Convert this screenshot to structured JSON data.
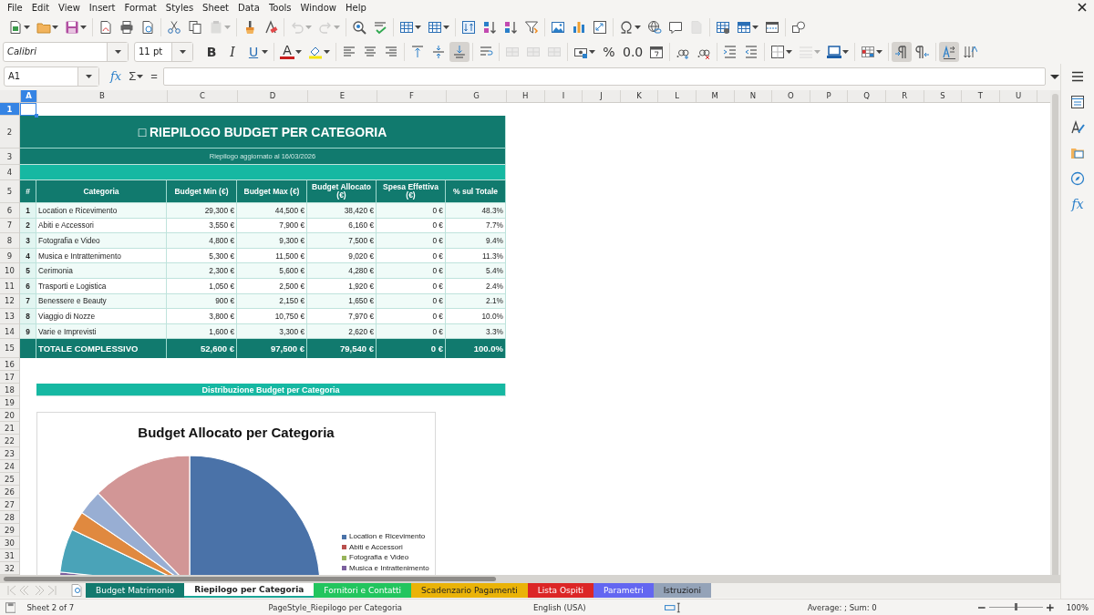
{
  "menu": [
    "File",
    "Edit",
    "View",
    "Insert",
    "Format",
    "Styles",
    "Sheet",
    "Data",
    "Tools",
    "Window",
    "Help"
  ],
  "toolbar_1": [
    [
      {
        "kind": "document",
        "on": false,
        "disabled": false
      },
      {
        "kind": "folder",
        "on": false,
        "disabled": false
      },
      {
        "kind": "floppy-disk",
        "on": false,
        "disabled": false
      }
    ],
    [
      {
        "kind": "pdf-document",
        "on": false,
        "disabled": false
      },
      {
        "kind": "printer",
        "on": false,
        "disabled": false
      },
      {
        "kind": "print-preview",
        "on": false,
        "disabled": false
      }
    ],
    [
      {
        "kind": "scissors",
        "on": false,
        "disabled": false
      },
      {
        "kind": "copy",
        "on": false,
        "disabled": false
      },
      {
        "kind": "clipboard",
        "on": false,
        "disabled": true
      }
    ],
    [
      {
        "kind": "paintbrush",
        "on": false,
        "disabled": false
      },
      {
        "kind": "clear-format",
        "on": false,
        "disabled": false
      }
    ],
    [
      {
        "kind": "undo",
        "on": false,
        "disabled": true
      },
      {
        "kind": "redo",
        "on": false,
        "disabled": true
      }
    ],
    [
      {
        "kind": "find-replace",
        "on": false,
        "disabled": false
      },
      {
        "kind": "spellcheck",
        "on": false,
        "disabled": false
      }
    ],
    [
      {
        "kind": "row-table",
        "on": false,
        "disabled": false
      },
      {
        "kind": "column-table",
        "on": false,
        "disabled": false
      }
    ],
    [
      {
        "kind": "sort",
        "on": false,
        "disabled": false
      },
      {
        "kind": "sort-ascending",
        "on": false,
        "disabled": false
      },
      {
        "kind": "sort-descending",
        "on": false,
        "disabled": false
      },
      {
        "kind": "filter",
        "on": false,
        "disabled": false
      }
    ],
    [
      {
        "kind": "image",
        "on": false,
        "disabled": false
      },
      {
        "kind": "bar-chart",
        "on": false,
        "disabled": false
      },
      {
        "kind": "pivot-table",
        "on": false,
        "disabled": false
      }
    ],
    [
      {
        "kind": "special-character",
        "on": false,
        "disabled": false
      },
      {
        "kind": "globe-link",
        "on": false,
        "disabled": false
      },
      {
        "kind": "comment",
        "on": false,
        "disabled": false
      },
      {
        "kind": "page",
        "on": false,
        "disabled": true
      }
    ],
    [
      {
        "kind": "print-area",
        "on": false,
        "disabled": false
      },
      {
        "kind": "freeze-rows",
        "on": false,
        "disabled": false
      },
      {
        "kind": "split-window",
        "on": false,
        "disabled": false
      }
    ],
    [
      {
        "kind": "shapes",
        "on": false,
        "disabled": false
      }
    ]
  ],
  "font_name": "Calibri",
  "font_size": "11 pt",
  "toolbar_2": [
    [
      {
        "kind": "bold",
        "label": "B",
        "on": false,
        "disabled": false
      },
      {
        "kind": "italic",
        "label": "I",
        "on": false,
        "disabled": false
      },
      {
        "kind": "underline",
        "label": "U",
        "on": false,
        "disabled": false
      }
    ],
    [
      {
        "kind": "font-color",
        "label": "A",
        "on": false,
        "disabled": false
      },
      {
        "kind": "highlight",
        "on": false,
        "disabled": false
      }
    ],
    [
      {
        "kind": "align-left",
        "on": false,
        "disabled": false
      },
      {
        "kind": "align-center",
        "on": false,
        "disabled": false
      },
      {
        "kind": "align-right",
        "on": false,
        "disabled": false
      }
    ],
    [
      {
        "kind": "align-top",
        "on": false,
        "disabled": false
      },
      {
        "kind": "align-middle",
        "on": false,
        "disabled": false
      },
      {
        "kind": "align-bottom",
        "on": true,
        "disabled": false
      }
    ],
    [
      {
        "kind": "wrap-text",
        "on": false,
        "disabled": false
      }
    ],
    [
      {
        "kind": "merge-cells",
        "on": false,
        "disabled": true
      },
      {
        "kind": "merge-center",
        "on": false,
        "disabled": true
      },
      {
        "kind": "unmerge-cells",
        "on": false,
        "disabled": true
      }
    ],
    [
      {
        "kind": "currency",
        "on": false,
        "disabled": false
      },
      {
        "kind": "percent",
        "label": "%",
        "on": false,
        "disabled": false
      },
      {
        "kind": "decimal-format",
        "label": "0.0",
        "on": false,
        "disabled": false
      },
      {
        "kind": "date",
        "on": false,
        "disabled": false
      }
    ],
    [
      {
        "kind": "add-decimal",
        "on": false,
        "disabled": false
      },
      {
        "kind": "delete-decimal",
        "on": false,
        "disabled": false
      }
    ],
    [
      {
        "kind": "increase-indent",
        "on": false,
        "disabled": false
      },
      {
        "kind": "decrease-indent",
        "on": false,
        "disabled": false
      }
    ],
    [
      {
        "kind": "borders",
        "on": false,
        "disabled": false
      },
      {
        "kind": "border-style",
        "on": false,
        "disabled": true
      },
      {
        "kind": "border-color",
        "on": false,
        "disabled": false
      }
    ],
    [
      {
        "kind": "conditional-format",
        "on": false,
        "disabled": false
      }
    ],
    [
      {
        "kind": "left-to-right",
        "on": true,
        "disabled": false
      },
      {
        "kind": "right-to-left",
        "on": false,
        "disabled": false
      }
    ],
    [
      {
        "kind": "text-direction-right",
        "on": true,
        "disabled": false
      },
      {
        "kind": "text-direction-down",
        "on": false,
        "disabled": false
      }
    ]
  ],
  "formula_bar": {
    "name_box": "A1",
    "function_wizard": "fx",
    "sum": "Σ",
    "equals": "="
  },
  "sidebar": {
    "functions": "fx"
  },
  "columns": [
    {
      "label": "A",
      "selected": true
    },
    {
      "label": "B",
      "selected": false
    },
    {
      "label": "C",
      "selected": false
    },
    {
      "label": "D",
      "selected": false
    },
    {
      "label": "E",
      "selected": false
    },
    {
      "label": "F",
      "selected": false
    },
    {
      "label": "G",
      "selected": false
    },
    {
      "label": "H",
      "selected": false
    },
    {
      "label": "I",
      "selected": false
    },
    {
      "label": "J",
      "selected": false
    },
    {
      "label": "K",
      "selected": false
    },
    {
      "label": "L",
      "selected": false
    },
    {
      "label": "M",
      "selected": false
    },
    {
      "label": "N",
      "selected": false
    },
    {
      "label": "O",
      "selected": false
    },
    {
      "label": "P",
      "selected": false
    },
    {
      "label": "Q",
      "selected": false
    },
    {
      "label": "R",
      "selected": false
    },
    {
      "label": "S",
      "selected": false
    },
    {
      "label": "T",
      "selected": false
    },
    {
      "label": "U",
      "selected": false
    }
  ],
  "rows": [
    {
      "label": "1",
      "selected": true
    },
    {
      "label": "2",
      "selected": false
    },
    {
      "label": "3",
      "selected": false
    },
    {
      "label": "4",
      "selected": false
    },
    {
      "label": "5",
      "selected": false
    },
    {
      "label": "6",
      "selected": false
    },
    {
      "label": "7",
      "selected": false
    },
    {
      "label": "8",
      "selected": false
    },
    {
      "label": "9",
      "selected": false
    },
    {
      "label": "10",
      "selected": false
    },
    {
      "label": "11",
      "selected": false
    },
    {
      "label": "12",
      "selected": false
    },
    {
      "label": "13",
      "selected": false
    },
    {
      "label": "14",
      "selected": false
    },
    {
      "label": "15",
      "selected": false
    },
    {
      "label": "16",
      "selected": false
    },
    {
      "label": "17",
      "selected": false
    },
    {
      "label": "18",
      "selected": false
    },
    {
      "label": "19",
      "selected": false
    },
    {
      "label": "20",
      "selected": false
    },
    {
      "label": "21",
      "selected": false
    },
    {
      "label": "22",
      "selected": false
    },
    {
      "label": "23",
      "selected": false
    },
    {
      "label": "24",
      "selected": false
    },
    {
      "label": "25",
      "selected": false
    },
    {
      "label": "26",
      "selected": false
    },
    {
      "label": "27",
      "selected": false
    },
    {
      "label": "28",
      "selected": false
    },
    {
      "label": "29",
      "selected": false
    },
    {
      "label": "30",
      "selected": false
    },
    {
      "label": "31",
      "selected": false
    },
    {
      "label": "32",
      "selected": false
    }
  ],
  "sheet": {
    "title": "□ RIEPILOGO BUDGET PER CATEGORIA",
    "subtitle": "Riepilogo aggiornato al 16/03/2026",
    "headers": [
      "#",
      "Categoria",
      "Budget Min (€)",
      "Budget Max (€)",
      "Budget Allocato (€)",
      "Spesa Effettiva (€)",
      "% sul Totale"
    ],
    "items": [
      {
        "num": "1",
        "category": "Location e Ricevimento",
        "min": "29,300 €",
        "max": "44,500 €",
        "allocated": "38,420 €",
        "spent": "0 €",
        "share": "48.3%"
      },
      {
        "num": "2",
        "category": "Abiti e Accessori",
        "min": "3,550 €",
        "max": "7,900 €",
        "allocated": "6,160 €",
        "spent": "0 €",
        "share": "7.7%"
      },
      {
        "num": "3",
        "category": "Fotografia e Video",
        "min": "4,800 €",
        "max": "9,300 €",
        "allocated": "7,500 €",
        "spent": "0 €",
        "share": "9.4%"
      },
      {
        "num": "4",
        "category": "Musica e Intrattenimento",
        "min": "5,300 €",
        "max": "11,500 €",
        "allocated": "9,020 €",
        "spent": "0 €",
        "share": "11.3%"
      },
      {
        "num": "5",
        "category": "Cerimonia",
        "min": "2,300 €",
        "max": "5,600 €",
        "allocated": "4,280 €",
        "spent": "0 €",
        "share": "5.4%"
      },
      {
        "num": "6",
        "category": "Trasporti e Logistica",
        "min": "1,050 €",
        "max": "2,500 €",
        "allocated": "1,920 €",
        "spent": "0 €",
        "share": "2.4%"
      },
      {
        "num": "7",
        "category": "Benessere e Beauty",
        "min": "900 €",
        "max": "2,150 €",
        "allocated": "1,650 €",
        "spent": "0 €",
        "share": "2.1%"
      },
      {
        "num": "8",
        "category": "Viaggio di Nozze",
        "min": "3,800 €",
        "max": "10,750 €",
        "allocated": "7,970 €",
        "spent": "0 €",
        "share": "10.0%"
      },
      {
        "num": "9",
        "category": "Varie e Imprevisti",
        "min": "1,600 €",
        "max": "3,300 €",
        "allocated": "2,620 €",
        "spent": "0 €",
        "share": "3.3%"
      }
    ],
    "total": {
      "label": "TOTALE COMPLESSIVO",
      "min": "52,600 €",
      "max": "97,500 €",
      "allocated": "79,540 €",
      "spent": "0 €",
      "share": "100.0%"
    },
    "section_title": "Distribuzione Budget per Categoria"
  },
  "chart": {
    "title": "Budget Allocato per Categoria",
    "legend": [
      {
        "label": "Location e Ricevimento",
        "color": "#4a72a8"
      },
      {
        "label": "Abiti e Accessori",
        "color": "#b9504d"
      },
      {
        "label": "Fotografia e Video",
        "color": "#98b45a"
      },
      {
        "label": "Musica e Intrattenimento",
        "color": "#7b609e"
      }
    ]
  },
  "sheet_tabs": [
    {
      "label": "Budget Matrimonio",
      "color": "#127a6e",
      "selected": false
    },
    {
      "label": "Riepilogo per Categoria",
      "color": "#1aa596",
      "selected": true
    },
    {
      "label": "Fornitori e Contatti",
      "color": "#22c55e",
      "selected": false
    },
    {
      "label": "Scadenzario Pagamenti",
      "color": "#eab308",
      "selected": false
    },
    {
      "label": "Lista Ospiti",
      "color": "#dc2626",
      "selected": false
    },
    {
      "label": "Parametri",
      "color": "#6366f1",
      "selected": false
    },
    {
      "label": "Istruzioni",
      "color": "#94a3b8",
      "selected": false
    }
  ],
  "status_bar": {
    "sheet": "Sheet 2 of 7",
    "page_style": "PageStyle_Riepilogo per Categoria",
    "language": "English (USA)",
    "selection_summary": "Average: ; Sum: 0",
    "zoom": {
      "level": 0.5,
      "reading": "100%"
    }
  }
}
